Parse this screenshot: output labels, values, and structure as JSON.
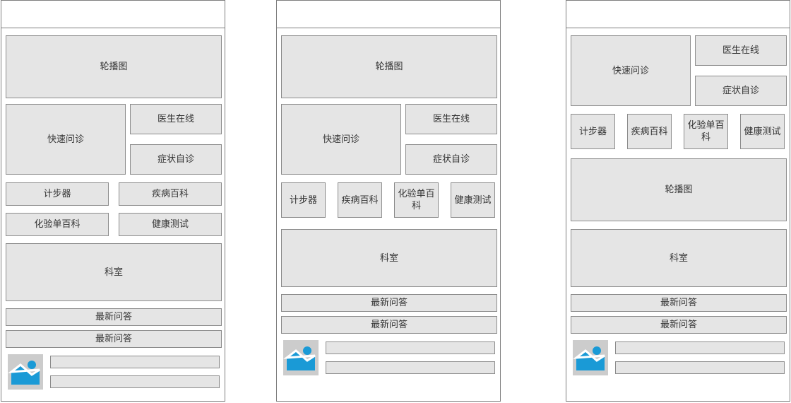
{
  "labels": {
    "carousel": "轮播图",
    "quick_consult": "快速问诊",
    "doctor_online": "医生在线",
    "symptom_check": "症状自诊",
    "pedometer": "计步器",
    "disease_wiki": "疾病百科",
    "lab_report_wiki": "化验单百科",
    "health_test": "健康测试",
    "department": "科室",
    "latest_qa": "最新问答"
  },
  "icons": {
    "image_placeholder": "image-icon"
  },
  "colors": {
    "block_fill": "#e5e5e5",
    "block_border": "#8c8c8c",
    "image_bg": "#cccccc",
    "image_accent": "#1a9ad6"
  }
}
